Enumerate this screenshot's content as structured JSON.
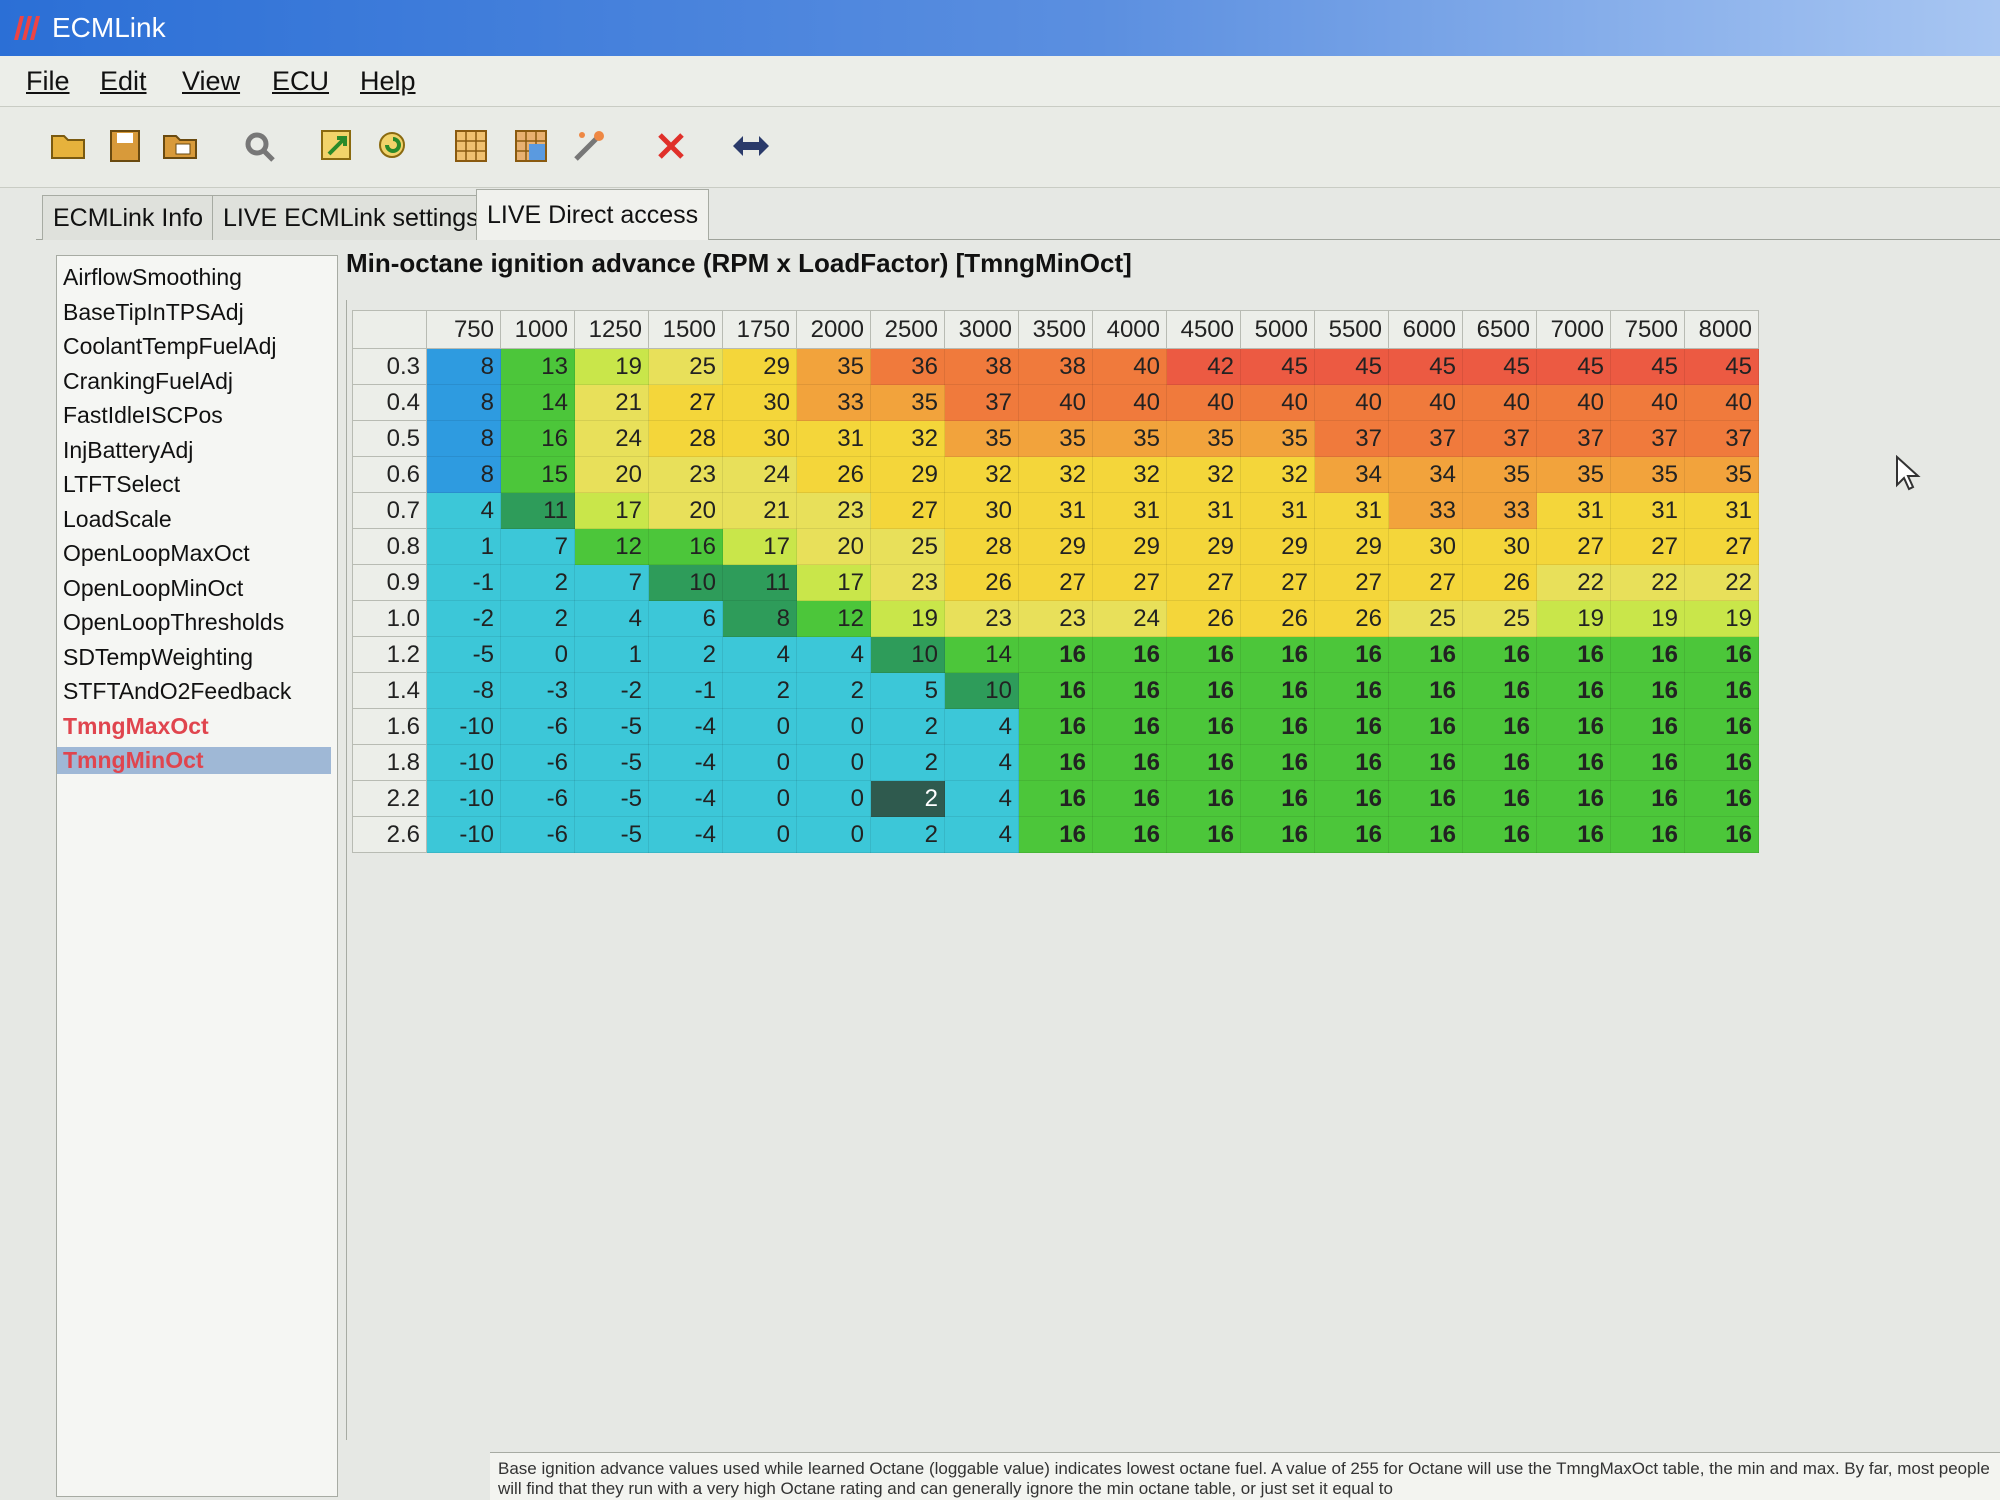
{
  "window": {
    "title": "ECMLink"
  },
  "menu": [
    "File",
    "Edit",
    "View",
    "ECU",
    "Help"
  ],
  "toolbar_icons": [
    "open-icon",
    "save-icon",
    "save-as-icon",
    "tools-icon",
    "upload-icon",
    "refresh-icon",
    "map-icon",
    "compare-icon",
    "wand-icon",
    "close-x-icon",
    "swap-arrows-icon"
  ],
  "tabs": [
    "ECMLink Info",
    "LIVE ECMLink settings",
    "LIVE Direct access"
  ],
  "active_tab": 2,
  "sidebar": {
    "items": [
      {
        "label": "AirflowSmoothing",
        "state": "normal"
      },
      {
        "label": "BaseTipInTPSAdj",
        "state": "normal"
      },
      {
        "label": "CoolantTempFuelAdj",
        "state": "normal"
      },
      {
        "label": "CrankingFuelAdj",
        "state": "normal"
      },
      {
        "label": "FastIdleISCPos",
        "state": "normal"
      },
      {
        "label": "InjBatteryAdj",
        "state": "normal"
      },
      {
        "label": "LTFTSelect",
        "state": "normal"
      },
      {
        "label": "LoadScale",
        "state": "normal"
      },
      {
        "label": "OpenLoopMaxOct",
        "state": "normal"
      },
      {
        "label": "OpenLoopMinOct",
        "state": "normal"
      },
      {
        "label": "OpenLoopThresholds",
        "state": "normal"
      },
      {
        "label": "SDTempWeighting",
        "state": "normal"
      },
      {
        "label": "STFTAndO2Feedback",
        "state": "normal"
      },
      {
        "label": "TmngMaxOct",
        "state": "modified"
      },
      {
        "label": "TmngMinOct",
        "state": "selected"
      }
    ]
  },
  "table": {
    "title": "Min-octane ignition advance (RPM x LoadFactor) [TmngMinOct]",
    "rpm": [
      "750",
      "1000",
      "1250",
      "1500",
      "1750",
      "2000",
      "2500",
      "3000",
      "3500",
      "4000",
      "4500",
      "5000",
      "5500",
      "6000",
      "6500",
      "7000",
      "7500",
      "8000"
    ],
    "load": [
      "0.3",
      "0.4",
      "0.5",
      "0.6",
      "0.7",
      "0.8",
      "0.9",
      "1.0",
      "1.2",
      "1.4",
      "1.6",
      "1.8",
      "2.2",
      "2.6"
    ],
    "values": [
      [
        8,
        13,
        19,
        25,
        29,
        35,
        36,
        38,
        38,
        40,
        42,
        45,
        45,
        45,
        45,
        45,
        45,
        45
      ],
      [
        8,
        14,
        21,
        27,
        30,
        33,
        35,
        37,
        40,
        40,
        40,
        40,
        40,
        40,
        40,
        40,
        40,
        40
      ],
      [
        8,
        16,
        24,
        28,
        30,
        31,
        32,
        35,
        35,
        35,
        35,
        35,
        37,
        37,
        37,
        37,
        37,
        37
      ],
      [
        8,
        15,
        20,
        23,
        24,
        26,
        29,
        32,
        32,
        32,
        32,
        32,
        34,
        34,
        35,
        35,
        35,
        35
      ],
      [
        4,
        11,
        17,
        20,
        21,
        23,
        27,
        30,
        31,
        31,
        31,
        31,
        31,
        33,
        33,
        31,
        31,
        31
      ],
      [
        1,
        7,
        12,
        16,
        17,
        20,
        25,
        28,
        29,
        29,
        29,
        29,
        29,
        30,
        30,
        27,
        27,
        27
      ],
      [
        -1,
        2,
        7,
        10,
        11,
        17,
        23,
        26,
        27,
        27,
        27,
        27,
        27,
        27,
        26,
        22,
        22,
        22
      ],
      [
        -2,
        2,
        4,
        6,
        8,
        12,
        19,
        23,
        23,
        24,
        26,
        26,
        26,
        25,
        25,
        19,
        19,
        19
      ],
      [
        -5,
        0,
        1,
        2,
        4,
        4,
        10,
        14,
        16,
        16,
        16,
        16,
        16,
        16,
        16,
        16,
        16,
        16
      ],
      [
        -8,
        -3,
        -2,
        -1,
        2,
        2,
        5,
        10,
        16,
        16,
        16,
        16,
        16,
        16,
        16,
        16,
        16,
        16
      ],
      [
        -10,
        -6,
        -5,
        -4,
        0,
        0,
        2,
        4,
        16,
        16,
        16,
        16,
        16,
        16,
        16,
        16,
        16,
        16
      ],
      [
        -10,
        -6,
        -5,
        -4,
        0,
        0,
        2,
        4,
        16,
        16,
        16,
        16,
        16,
        16,
        16,
        16,
        16,
        16
      ],
      [
        -10,
        -6,
        -5,
        -4,
        0,
        0,
        2,
        4,
        16,
        16,
        16,
        16,
        16,
        16,
        16,
        16,
        16,
        16
      ],
      [
        -10,
        -6,
        -5,
        -4,
        0,
        0,
        2,
        4,
        16,
        16,
        16,
        16,
        16,
        16,
        16,
        16,
        16,
        16
      ]
    ]
  },
  "description": "Base ignition advance values used while learned Octane (loggable value) indicates lowest octane fuel. A value of 255 for Octane will use the TmngMaxOct table, the min and max. By far, most people will find that they run with a very high Octane rating and can generally ignore the min octane table, or just set it equal to",
  "colors": {
    "cyan": "#3cc7d8",
    "blue": "#2e9be0",
    "green": "#4cc63a",
    "darkgreen": "#2e9c5a",
    "yellowgreen": "#c9e64a",
    "yellow": "#f4d63a",
    "orange": "#f2a33c",
    "red": "#ec5a42"
  }
}
